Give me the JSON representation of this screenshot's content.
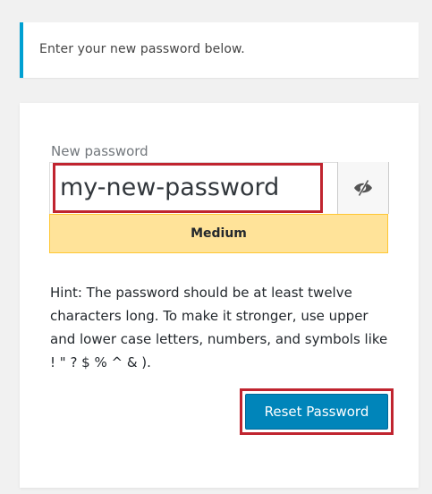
{
  "message": {
    "text": "Enter your new password below."
  },
  "form": {
    "password_label": "New password",
    "password_value": "my-new-password",
    "toggle_icon": "eye-slash-icon",
    "strength_text": "Medium",
    "hint": "Hint: The password should be at least twelve characters long. To make it stronger, use upper and lower case letters, numbers, and symbols like ! \" ? $ % ^ & ).",
    "submit_label": "Reset Password"
  },
  "colors": {
    "accent_border": "#00a0d2",
    "highlight": "#c0242f",
    "strength_bg": "#ffe399",
    "button_bg": "#0085ba"
  }
}
